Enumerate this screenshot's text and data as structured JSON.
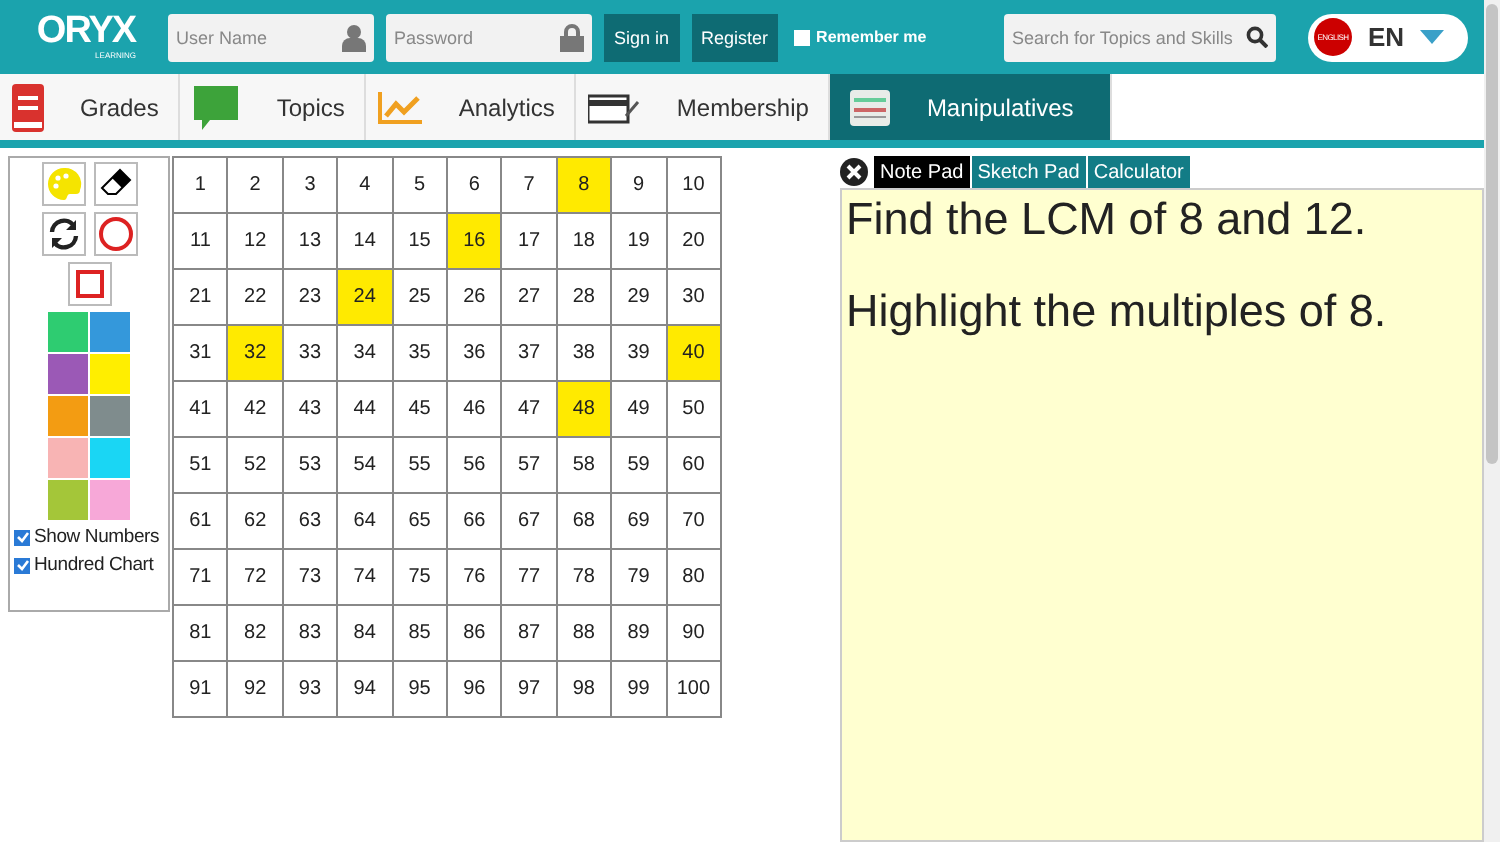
{
  "header": {
    "logo": {
      "name": "ORYX",
      "tagline": "LEARNING"
    },
    "username": {
      "placeholder": "User Name"
    },
    "password": {
      "placeholder": "Password"
    },
    "buttons": [
      "Sign in",
      "Register"
    ],
    "remember_me": {
      "label": "Remember me",
      "checked": false
    },
    "search": {
      "placeholder": "Search for Topics and Skills"
    },
    "language": {
      "badge": "ENGLISH",
      "code": "EN"
    }
  },
  "nav": [
    {
      "label": "Grades",
      "kind": "book",
      "selected": false
    },
    {
      "label": "Topics",
      "kind": "chat",
      "selected": false
    },
    {
      "label": "Analytics",
      "kind": "chart",
      "selected": false
    },
    {
      "label": "Membership",
      "kind": "card",
      "selected": false
    },
    {
      "label": "Manipulatives",
      "kind": "abacus",
      "selected": true
    }
  ],
  "tools": {
    "swatches": [
      {
        "color": "#2ecc71"
      },
      {
        "color": "#3498db"
      },
      {
        "color": "#9b59b6"
      },
      {
        "color": "#ffee00"
      },
      {
        "color": "#f39c12"
      },
      {
        "color": "#7f8c8d"
      },
      {
        "color": "#f8b4b4"
      },
      {
        "color": "#1ad6f4"
      },
      {
        "color": "#a4c639"
      },
      {
        "color": "#f7a8d8"
      }
    ],
    "options": [
      {
        "label": "Show Numbers",
        "checked": true
      },
      {
        "label": "Hundred Chart",
        "checked": true
      }
    ]
  },
  "hundred_chart": {
    "cells": [
      {
        "label": "1",
        "selected": false
      },
      {
        "label": "2",
        "selected": false
      },
      {
        "label": "3",
        "selected": false
      },
      {
        "label": "4",
        "selected": false
      },
      {
        "label": "5",
        "selected": false
      },
      {
        "label": "6",
        "selected": false
      },
      {
        "label": "7",
        "selected": false
      },
      {
        "label": "8",
        "selected": true
      },
      {
        "label": "9",
        "selected": false
      },
      {
        "label": "10",
        "selected": false
      },
      {
        "label": "11",
        "selected": false
      },
      {
        "label": "12",
        "selected": false
      },
      {
        "label": "13",
        "selected": false
      },
      {
        "label": "14",
        "selected": false
      },
      {
        "label": "15",
        "selected": false
      },
      {
        "label": "16",
        "selected": true
      },
      {
        "label": "17",
        "selected": false
      },
      {
        "label": "18",
        "selected": false
      },
      {
        "label": "19",
        "selected": false
      },
      {
        "label": "20",
        "selected": false
      },
      {
        "label": "21",
        "selected": false
      },
      {
        "label": "22",
        "selected": false
      },
      {
        "label": "23",
        "selected": false
      },
      {
        "label": "24",
        "selected": true
      },
      {
        "label": "25",
        "selected": false
      },
      {
        "label": "26",
        "selected": false
      },
      {
        "label": "27",
        "selected": false
      },
      {
        "label": "28",
        "selected": false
      },
      {
        "label": "29",
        "selected": false
      },
      {
        "label": "30",
        "selected": false
      },
      {
        "label": "31",
        "selected": false
      },
      {
        "label": "32",
        "selected": true
      },
      {
        "label": "33",
        "selected": false
      },
      {
        "label": "34",
        "selected": false
      },
      {
        "label": "35",
        "selected": false
      },
      {
        "label": "36",
        "selected": false
      },
      {
        "label": "37",
        "selected": false
      },
      {
        "label": "38",
        "selected": false
      },
      {
        "label": "39",
        "selected": false
      },
      {
        "label": "40",
        "selected": true
      },
      {
        "label": "41",
        "selected": false
      },
      {
        "label": "42",
        "selected": false
      },
      {
        "label": "43",
        "selected": false
      },
      {
        "label": "44",
        "selected": false
      },
      {
        "label": "45",
        "selected": false
      },
      {
        "label": "46",
        "selected": false
      },
      {
        "label": "47",
        "selected": false
      },
      {
        "label": "48",
        "selected": true
      },
      {
        "label": "49",
        "selected": false
      },
      {
        "label": "50",
        "selected": false
      },
      {
        "label": "51",
        "selected": false
      },
      {
        "label": "52",
        "selected": false
      },
      {
        "label": "53",
        "selected": false
      },
      {
        "label": "54",
        "selected": false
      },
      {
        "label": "55",
        "selected": false
      },
      {
        "label": "56",
        "selected": false
      },
      {
        "label": "57",
        "selected": false
      },
      {
        "label": "58",
        "selected": false
      },
      {
        "label": "59",
        "selected": false
      },
      {
        "label": "60",
        "selected": false
      },
      {
        "label": "61",
        "selected": false
      },
      {
        "label": "62",
        "selected": false
      },
      {
        "label": "63",
        "selected": false
      },
      {
        "label": "64",
        "selected": false
      },
      {
        "label": "65",
        "selected": false
      },
      {
        "label": "66",
        "selected": false
      },
      {
        "label": "67",
        "selected": false
      },
      {
        "label": "68",
        "selected": false
      },
      {
        "label": "69",
        "selected": false
      },
      {
        "label": "70",
        "selected": false
      },
      {
        "label": "71",
        "selected": false
      },
      {
        "label": "72",
        "selected": false
      },
      {
        "label": "73",
        "selected": false
      },
      {
        "label": "74",
        "selected": false
      },
      {
        "label": "75",
        "selected": false
      },
      {
        "label": "76",
        "selected": false
      },
      {
        "label": "77",
        "selected": false
      },
      {
        "label": "78",
        "selected": false
      },
      {
        "label": "79",
        "selected": false
      },
      {
        "label": "80",
        "selected": false
      },
      {
        "label": "81",
        "selected": false
      },
      {
        "label": "82",
        "selected": false
      },
      {
        "label": "83",
        "selected": false
      },
      {
        "label": "84",
        "selected": false
      },
      {
        "label": "85",
        "selected": false
      },
      {
        "label": "86",
        "selected": false
      },
      {
        "label": "87",
        "selected": false
      },
      {
        "label": "88",
        "selected": false
      },
      {
        "label": "89",
        "selected": false
      },
      {
        "label": "90",
        "selected": false
      },
      {
        "label": "91",
        "selected": false
      },
      {
        "label": "92",
        "selected": false
      },
      {
        "label": "93",
        "selected": false
      },
      {
        "label": "94",
        "selected": false
      },
      {
        "label": "95",
        "selected": false
      },
      {
        "label": "96",
        "selected": false
      },
      {
        "label": "97",
        "selected": false
      },
      {
        "label": "98",
        "selected": false
      },
      {
        "label": "99",
        "selected": false
      },
      {
        "label": "100",
        "selected": false
      }
    ]
  },
  "notepad": {
    "tabs": [
      {
        "label": "Note Pad",
        "selected": true
      },
      {
        "label": "Sketch Pad",
        "selected": false
      },
      {
        "label": "Calculator",
        "selected": false
      }
    ],
    "lines": [
      "Find the LCM of 8 and 12.",
      "Highlight the multiples of 8."
    ]
  }
}
